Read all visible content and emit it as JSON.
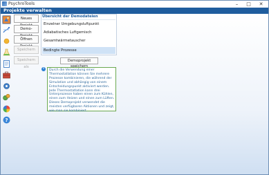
{
  "window": {
    "title": "PsychroTools",
    "controls": {
      "minimize": "–",
      "maximize": "□",
      "close": "✕"
    }
  },
  "header": {
    "title": "Projekte verwalten"
  },
  "sidebar": {
    "icons": [
      {
        "name": "projects-icon",
        "selected": true
      },
      {
        "name": "diagram-icon",
        "selected": false
      },
      {
        "name": "sun-icon",
        "selected": false
      },
      {
        "name": "flask-icon",
        "selected": false
      },
      {
        "name": "document-icon",
        "selected": false
      },
      {
        "name": "toolbox-icon",
        "selected": false
      },
      {
        "name": "gear-icon",
        "selected": false
      },
      {
        "name": "currency-icon",
        "selected": false
      },
      {
        "name": "color-wheel-icon",
        "selected": false
      },
      {
        "name": "help-icon",
        "selected": false
      }
    ]
  },
  "actions": {
    "new_project": "Neues Projekt",
    "demo_project": "Demo-Projekt",
    "open_project": "Öffnen Projekt",
    "save": "Speichern",
    "save_as": "Speichern als"
  },
  "demo_list": {
    "heading": "Übersicht der Demodateien",
    "items": [
      {
        "label": "Einzelner Umgebungsluftpunkt",
        "selected": false
      },
      {
        "label": "Adiabatisches Luftgemisch",
        "selected": false
      },
      {
        "label": "Gesamtwärmetauscher",
        "selected": false
      },
      {
        "label": "Bedingte Prozesse",
        "selected": true
      }
    ],
    "save_button": "Demoprojekt speichern"
  },
  "info": {
    "icon": "info-icon",
    "text": "Durch die Verwendung einer Thermostatlation können Sie mehrere Prozesse kombinieren, die während der Simulation und abhängig von einem Entscheidungspunkt aktiviert werden. Jede Thermostatlation kann drei Unterprozesse haben einen zum Kühlen, einen zum Heizen und einen zum Lüften. Dieses Demoprojekt verwendet die meisten verfügbaren Aktionen und zeigt, wie man sie kombiniert."
  }
}
